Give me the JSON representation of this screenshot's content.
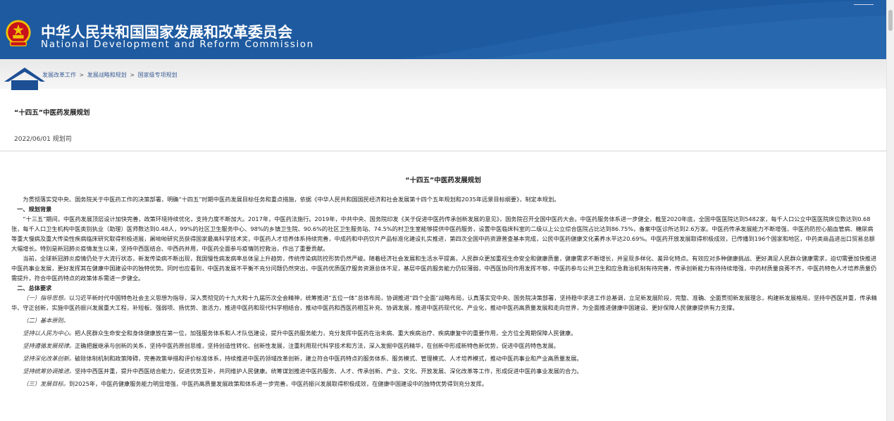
{
  "header": {
    "title_cn": "中华人民共和国国家发展和改革委员会",
    "title_en": "National Development and Reform Commission",
    "colors": {
      "band": "#1e5aa0",
      "emblem_red": "#c8121c",
      "emblem_gold": "#f2c200"
    }
  },
  "breadcrumb": {
    "items": [
      "发展改革工作",
      "发展战略和规划",
      "国家级专项规划"
    ],
    "separator": ">"
  },
  "article": {
    "title": "“十四五”中医药发展规划",
    "date": "2022/06/01",
    "source": "规划司",
    "doc_title": "“十四五”中医药发展规划"
  },
  "body": {
    "p1": "为贯彻落实党中央、国务院关于中医药工作的决策部署，明确“十四五”时期中医药发展目标任务和重点措施，依据《中华人民共和国国民经济和社会发展第十四个五年规划和2035年远景目标纲要》，制定本规划。",
    "h1": "一、规划背景",
    "p2": "“十三五”期间，中医药发展顶层设计加快完善，政策环境持续优化，支持力度不断加大。2017年，中医药法施行。2019年，中共中央、国务院印发《关于促进中医药传承创新发展的意见》，国务院召开全国中医药大会。中医药服务体系进一步健全，截至2020年底，全国中医医院达到5482家，每千人口公立中医医院床位数达到0.68张，每千人口卫生机构中医类别执业（助理）医师数达到0.48人，99%的社区卫生服务中心、98%的乡镇卫生院、90.6%的社区卫生服务站、74.5%的村卫生室能够提供中医药服务，设置中医临床科室的二级以上公立综合医院占比达到86.75%，备案中医诊所达到2.6万家。中医药传承发展能力不断增强，中医药防控心脑血管病、糖尿病等重大慢病及重大传染性疾病临床研究取得积极进展，屠呦呦研究员获得国家最高科学技术奖，中医药人才培养体系持续完善，中成药和中药饮片产品标准化建设扎实推进，第四次全国中药资源普查基本完成，公民中医药健康文化素养水平达20.69%。中医药开放发展取得积极成效，已传播到196个国家和地区，中药类商品进出口贸易总额大幅增长。特别是新冠肺炎疫情发生以来，坚持中西医结合、中西药并用，中医药全面参与疫情防控救治，作出了重要贡献。",
    "p3": "当前，全球新冠肺炎疫情仍处于大流行状态，新发传染病不断出现，我国慢性病发病率总体呈上升趋势，传统传染病防控形势仍然严峻。随着经济社会发展和生活水平提高，人民群众更加重视生命安全和健康质量，健康需求不断增长，并呈现多样化、差异化特点。有效应对多种健康挑战、更好满足人民群众健康需求，迫切需要加快推进中医药事业发展，更好发挥其在健康中国建设中的独特优势。同时也应看到，中医药发展不平衡不充分问题仍然突出，中医药优质医疗服务资源总体不足，基层中医药服务能力仍较薄弱，中西医协同作用发挥不够，中医药参与公共卫生和应急救治机制有待完善，传承创新能力有待持续增强，中药材质量良莠不齐，中医药特色人才培养质量仍需提升，符合中医药特点的政策体系需进一步健全。",
    "h2": "二、总体要求",
    "p4_lead": "（一）指导思想。",
    "p4": "以习近平新时代中国特色社会主义思想为指导，深入贯彻党的十九大和十九届历次全会精神，统筹推进“五位一体”总体布局，协调推进“四个全面”战略布局，认真落实党中央、国务院决策部署，坚持稳中求进工作总基调，立足新发展阶段，完整、准确、全面贯彻新发展理念，构建新发展格局，坚持中西医并重，传承精华、守正创新，实施中医药振兴发展重大工程，补短板、强弱项、扬优势、激活力，推进中医药和现代科学相结合，推动中医药和西医药相互补充、协调发展，推进中医药现代化、产业化，推动中医药高质量发展和走向世界，为全面推进健康中国建设、更好保障人民健康提供有力支撑。",
    "p5": "（二）基本原则。",
    "p6_lead": "坚持以人民为中心。",
    "p6": "把人民群众生命安全和身体健康放在第一位，加强服务体系和人才队伍建设，提升中医药服务能力，充分发挥中医药在治未病、重大疾病治疗、疾病康复中的重要作用，全方位全周期保障人民健康。",
    "p7_lead": "坚持遵循发展规律。",
    "p7": "正确把握继承与创新的关系，坚持中医药原创思维，坚持创造性转化、创新性发展，注重利用现代科学技术和方法，深入发掘中医药精华，在创新中形成新特色新优势，促进中医药特色发展。",
    "p8_lead": "坚持深化改革创新。",
    "p8": "破除体制机制和政策障碍，完善政策举措和评价标准体系，持续推进中医药领域改革创新，建立符合中医药特点的服务体系、服务模式、管理模式、人才培养模式，推动中医药事业和产业高质量发展。",
    "p9_lead": "坚持统筹协调推进。",
    "p9": "坚持中西医并重，提升中西医结合能力，促进优势互补，共同维护人民健康。统筹谋划推进中医药服务、人才、传承创新、产业、文化、开放发展、深化改革等工作，形成促进中医药事业发展的合力。",
    "p10_lead": "（三）发展目标。",
    "p10": "到2025年，中医药健康服务能力明显增强，中医药高质量发展政策和体系进一步完善，中医药振兴发展取得积极成效，在健康中国建设中的独特优势得到充分发挥。"
  }
}
